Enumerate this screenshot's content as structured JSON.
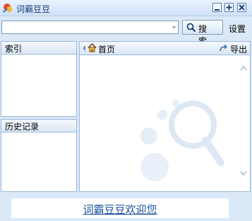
{
  "window": {
    "title": "词霸豆豆",
    "controls": [
      "minimize-icon",
      "maximize-icon",
      "close-icon"
    ]
  },
  "search": {
    "value": "",
    "placeholder": "",
    "button_label": "搜 索",
    "settings_label": "设置"
  },
  "index_panel": {
    "title": "索引"
  },
  "history_panel": {
    "title": "历史记录"
  },
  "content": {
    "home_label": "首页",
    "export_label": "导出"
  },
  "footer": {
    "welcome_link": "词霸豆豆欢迎您"
  },
  "colors": {
    "background": "#dbe8f7",
    "border": "#9bb7da",
    "link": "#1a4f9c"
  }
}
